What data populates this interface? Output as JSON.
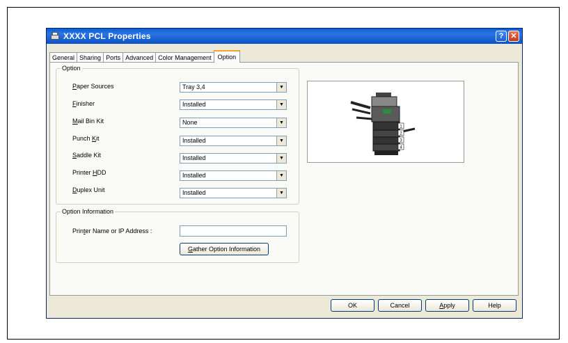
{
  "window": {
    "title": "XXXX PCL Properties",
    "help_glyph": "?",
    "close_glyph": "✕",
    "icon": "printer-icon"
  },
  "tabs": [
    "General",
    "Sharing",
    "Ports",
    "Advanced",
    "Color Management",
    "Option"
  ],
  "active_tab": "Option",
  "option_group": {
    "legend": "Option",
    "rows": [
      {
        "pre": "",
        "mnemonic": "P",
        "post": "aper Sources",
        "value": "Tray 3,4"
      },
      {
        "pre": "",
        "mnemonic": "F",
        "post": "inisher",
        "value": "Installed"
      },
      {
        "pre": "",
        "mnemonic": "M",
        "post": "ail Bin Kit",
        "value": "None"
      },
      {
        "pre": "Punch ",
        "mnemonic": "K",
        "post": "it",
        "value": "Installed"
      },
      {
        "pre": "",
        "mnemonic": "S",
        "post": "addle Kit",
        "value": "Installed"
      },
      {
        "pre": "Printer ",
        "mnemonic": "H",
        "post": "DD",
        "value": "Installed"
      },
      {
        "pre": "",
        "mnemonic": "D",
        "post": "uplex Unit",
        "value": "Installed"
      }
    ],
    "arrow_glyph": "▼"
  },
  "option_info": {
    "legend": "Option Information",
    "label_pre": "Prin",
    "label_mnemonic": "t",
    "label_post": "er Name or IP Address :",
    "value": "",
    "gather_mnemonic": "G",
    "gather_post": "ather Option Information"
  },
  "footer_buttons": {
    "ok": "OK",
    "cancel": "Cancel",
    "apply_mnemonic": "A",
    "apply_post": "pply",
    "help": "Help"
  },
  "preview": {
    "tray_numbers": [
      "1",
      "2",
      "3",
      "4"
    ]
  },
  "colors": {
    "titlebar": "#0a5fd8",
    "dialog_bg": "#ece9d8",
    "active_tab_accent": "#f5a623"
  }
}
